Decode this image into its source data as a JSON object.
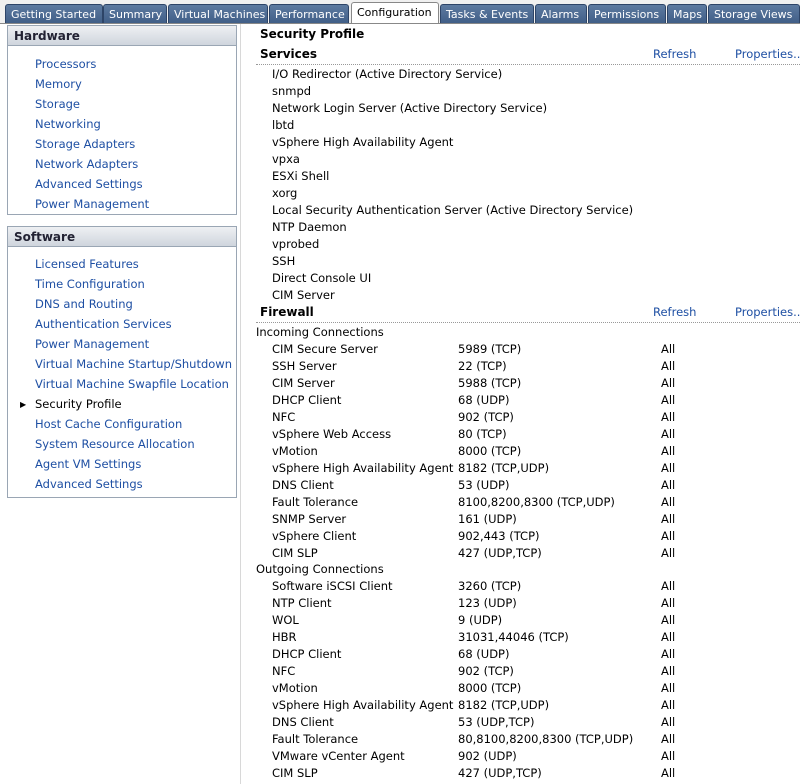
{
  "tabs": [
    {
      "label": "Getting Started",
      "active": false
    },
    {
      "label": "Summary",
      "active": false
    },
    {
      "label": "Virtual Machines",
      "active": false
    },
    {
      "label": "Performance",
      "active": false
    },
    {
      "label": "Configuration",
      "active": true
    },
    {
      "label": "Tasks & Events",
      "active": false
    },
    {
      "label": "Alarms",
      "active": false
    },
    {
      "label": "Permissions",
      "active": false
    },
    {
      "label": "Maps",
      "active": false
    },
    {
      "label": "Storage Views",
      "active": false
    }
  ],
  "hardware": {
    "title": "Hardware",
    "items": [
      "Processors",
      "Memory",
      "Storage",
      "Networking",
      "Storage Adapters",
      "Network Adapters",
      "Advanced Settings",
      "Power Management"
    ]
  },
  "software": {
    "title": "Software",
    "items": [
      "Licensed Features",
      "Time Configuration",
      "DNS and Routing",
      "Authentication Services",
      "Power Management",
      "Virtual Machine Startup/Shutdown",
      "Virtual Machine Swapfile Location",
      "Security Profile",
      "Host Cache Configuration",
      "System Resource Allocation",
      "Agent VM Settings",
      "Advanced Settings"
    ],
    "selected_index": 7
  },
  "security_profile": {
    "title": "Security Profile",
    "services": {
      "title": "Services",
      "refresh": "Refresh",
      "properties": "Properties...",
      "items": [
        "I/O Redirector (Active Directory Service)",
        "snmpd",
        "Network Login Server (Active Directory Service)",
        "lbtd",
        "vSphere High Availability Agent",
        "vpxa",
        "ESXi Shell",
        "xorg",
        "Local Security Authentication Server (Active Directory Service)",
        "NTP Daemon",
        "vprobed",
        "SSH",
        "Direct Console UI",
        "CIM Server"
      ]
    },
    "firewall": {
      "title": "Firewall",
      "refresh": "Refresh",
      "properties": "Properties...",
      "incoming_label": "Incoming Connections",
      "incoming": [
        {
          "name": "CIM Secure Server",
          "port": "5989 (TCP)",
          "allowed": "All"
        },
        {
          "name": "SSH Server",
          "port": "22 (TCP)",
          "allowed": "All"
        },
        {
          "name": "CIM Server",
          "port": "5988 (TCP)",
          "allowed": "All"
        },
        {
          "name": "DHCP Client",
          "port": "68 (UDP)",
          "allowed": "All"
        },
        {
          "name": "NFC",
          "port": "902 (TCP)",
          "allowed": "All"
        },
        {
          "name": "vSphere Web Access",
          "port": "80 (TCP)",
          "allowed": "All"
        },
        {
          "name": "vMotion",
          "port": "8000 (TCP)",
          "allowed": "All"
        },
        {
          "name": "vSphere High Availability Agent",
          "port": "8182 (TCP,UDP)",
          "allowed": "All"
        },
        {
          "name": "DNS Client",
          "port": "53 (UDP)",
          "allowed": "All"
        },
        {
          "name": "Fault Tolerance",
          "port": "8100,8200,8300 (TCP,UDP)",
          "allowed": "All"
        },
        {
          "name": "SNMP Server",
          "port": "161 (UDP)",
          "allowed": "All"
        },
        {
          "name": "vSphere Client",
          "port": "902,443 (TCP)",
          "allowed": "All"
        },
        {
          "name": "CIM SLP",
          "port": "427 (UDP,TCP)",
          "allowed": "All"
        }
      ],
      "outgoing_label": "Outgoing Connections",
      "outgoing": [
        {
          "name": "Software iSCSI Client",
          "port": "3260 (TCP)",
          "allowed": "All"
        },
        {
          "name": "NTP Client",
          "port": "123 (UDP)",
          "allowed": "All"
        },
        {
          "name": "WOL",
          "port": "9 (UDP)",
          "allowed": "All"
        },
        {
          "name": "HBR",
          "port": "31031,44046 (TCP)",
          "allowed": "All"
        },
        {
          "name": "DHCP Client",
          "port": "68 (UDP)",
          "allowed": "All"
        },
        {
          "name": "NFC",
          "port": "902 (TCP)",
          "allowed": "All"
        },
        {
          "name": "vMotion",
          "port": "8000 (TCP)",
          "allowed": "All"
        },
        {
          "name": "vSphere High Availability Agent",
          "port": "8182 (TCP,UDP)",
          "allowed": "All"
        },
        {
          "name": "DNS Client",
          "port": "53 (UDP,TCP)",
          "allowed": "All"
        },
        {
          "name": "Fault Tolerance",
          "port": "80,8100,8200,8300 (TCP,UDP)",
          "allowed": "All"
        },
        {
          "name": "VMware vCenter Agent",
          "port": "902 (UDP)",
          "allowed": "All"
        },
        {
          "name": "CIM SLP",
          "port": "427 (UDP,TCP)",
          "allowed": "All"
        }
      ]
    }
  }
}
